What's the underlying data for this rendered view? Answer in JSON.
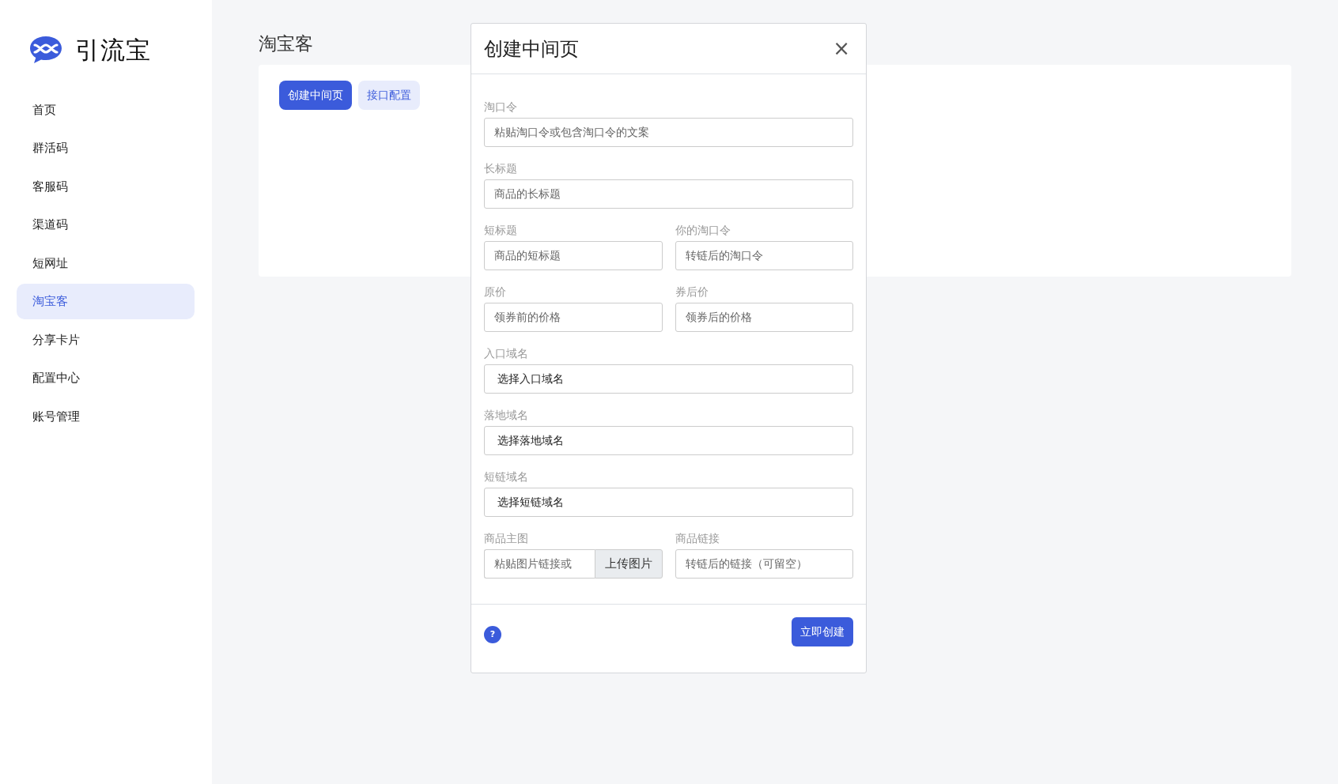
{
  "logo": {
    "text": "引流宝"
  },
  "sidebar": {
    "items": [
      {
        "label": "首页",
        "selected": false
      },
      {
        "label": "群活码",
        "selected": false
      },
      {
        "label": "客服码",
        "selected": false
      },
      {
        "label": "渠道码",
        "selected": false
      },
      {
        "label": "短网址",
        "selected": false
      },
      {
        "label": "淘宝客",
        "selected": true
      },
      {
        "label": "分享卡片",
        "selected": false
      },
      {
        "label": "配置中心",
        "selected": false
      },
      {
        "label": "账号管理",
        "selected": false
      }
    ]
  },
  "page": {
    "title": "淘宝客",
    "buttons": [
      {
        "label": "创建中间页",
        "kind": "primary"
      },
      {
        "label": "接口配置",
        "kind": "light"
      }
    ]
  },
  "dialog": {
    "title": "创建中间页",
    "close": "×",
    "rows": [
      [
        {
          "label": "淘口令",
          "kind": "input",
          "placeholder": "粘贴淘口令或包含淘口令的文案"
        }
      ],
      [
        {
          "label": "长标题",
          "kind": "input",
          "placeholder": "商品的长标题"
        }
      ],
      [
        {
          "label": "短标题",
          "kind": "input",
          "placeholder": "商品的短标题"
        },
        {
          "label": "你的淘口令",
          "kind": "input",
          "placeholder": "转链后的淘口令"
        }
      ],
      [
        {
          "label": "原价",
          "kind": "input",
          "placeholder": "领券前的价格"
        },
        {
          "label": "券后价",
          "kind": "input",
          "placeholder": "领券后的价格"
        }
      ],
      [
        {
          "label": "入口域名",
          "kind": "select",
          "value": "选择入口域名"
        }
      ],
      [
        {
          "label": "落地域名",
          "kind": "select",
          "value": "选择落地域名"
        }
      ],
      [
        {
          "label": "短链域名",
          "kind": "select",
          "value": "选择短链域名"
        }
      ],
      [
        {
          "label": "商品主图",
          "kind": "upload",
          "placeholder": "粘贴图片链接或",
          "button": "上传图片"
        },
        {
          "label": "商品链接",
          "kind": "input",
          "placeholder": "转链后的链接（可留空）"
        }
      ]
    ],
    "help": "?",
    "submit": "立即创建"
  }
}
